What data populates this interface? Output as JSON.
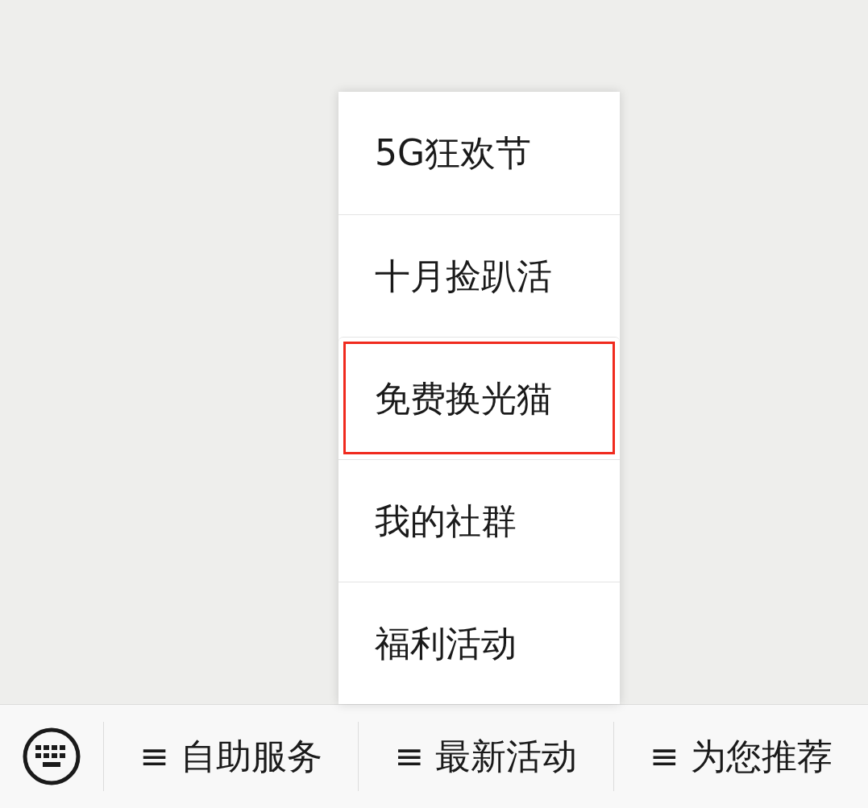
{
  "popup_menu": {
    "items": [
      {
        "label": "5G狂欢节",
        "selected": false
      },
      {
        "label": "十月捡趴活",
        "selected": false
      },
      {
        "label": "免费换光猫",
        "selected": true
      },
      {
        "label": "我的社群",
        "selected": false
      },
      {
        "label": "福利活动",
        "selected": false
      }
    ]
  },
  "bottom_menu": {
    "tabs": [
      {
        "label": "≡ 自助服务"
      },
      {
        "label": "≡ 最新活动"
      },
      {
        "label": "≡ 为您推荐"
      }
    ]
  }
}
